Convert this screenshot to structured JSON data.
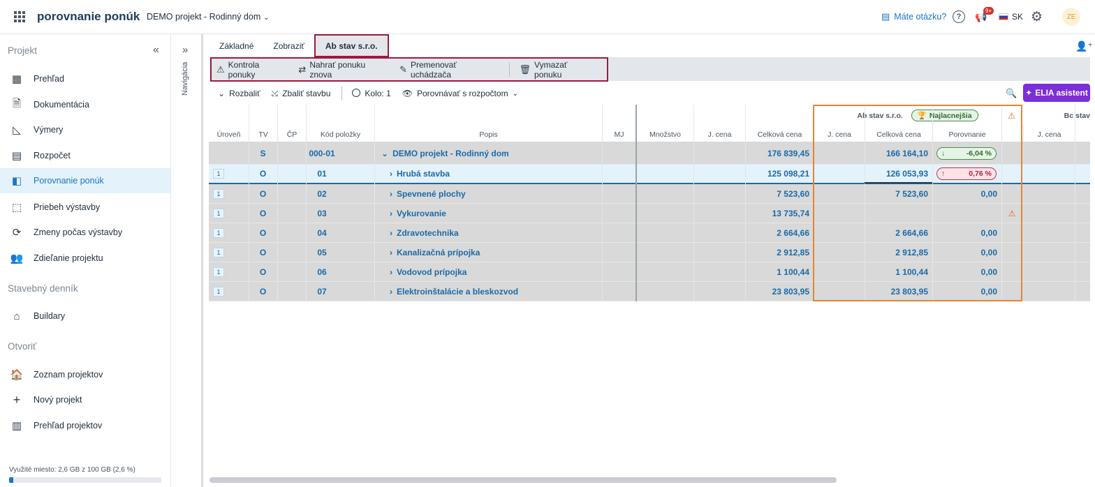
{
  "header": {
    "app_title": "porovnanie ponúk",
    "project": "DEMO projekt - Rodinný dom",
    "help": "Máte otázku?",
    "notif_badge": "9+",
    "language": "SK",
    "avatar": "ZE"
  },
  "sidebar": {
    "section_project": "Projekt",
    "section_diary": "Stavebný denník",
    "section_open": "Otvoriť",
    "items_project": [
      {
        "label": "Prehľad",
        "icon": "dashboard-icon"
      },
      {
        "label": "Dokumentácia",
        "icon": "document-icon"
      },
      {
        "label": "Výmery",
        "icon": "measure-icon"
      },
      {
        "label": "Rozpočet",
        "icon": "budget-icon"
      },
      {
        "label": "Porovnanie ponúk",
        "icon": "compare-icon",
        "active": true
      },
      {
        "label": "Priebeh výstavby",
        "icon": "progress-icon"
      },
      {
        "label": "Zmeny počas výstavby",
        "icon": "changes-icon"
      },
      {
        "label": "Zdieľanie projektu",
        "icon": "people-icon"
      }
    ],
    "items_diary": [
      {
        "label": "Buildary",
        "icon": "buildary-icon"
      }
    ],
    "items_open": [
      {
        "label": "Zoznam projektov",
        "icon": "home-icon"
      },
      {
        "label": "Nový projekt",
        "icon": "plus-icon"
      },
      {
        "label": "Prehľad projektov",
        "icon": "report-icon"
      }
    ],
    "storage_label": "Využité miesto: 2,6 GB z 100 GB (2,6 %)",
    "storage_percent": 2.6
  },
  "navcol": {
    "label": "Navigácia"
  },
  "tabs": [
    "Základné",
    "Zobraziť",
    "Ab stav s.r.o."
  ],
  "actions": [
    {
      "label": "Kontrola ponuky",
      "icon": "warning-icon"
    },
    {
      "label": "Nahrať ponuku znova",
      "icon": "repeat-icon"
    },
    {
      "label": "Premenovať uchádzača",
      "icon": "pencil-icon"
    },
    {
      "label": "Vymazať ponuku",
      "icon": "trash-icon"
    }
  ],
  "toolbar": {
    "expand": "Rozbaliť",
    "collapse": "Zbaliť stavbu",
    "round": "Kolo: 1",
    "compare": "Porovnávať s rozpočtom",
    "elia": "ELIA asistent"
  },
  "grid": {
    "columns": {
      "level": "Úroveň",
      "tv": "TV",
      "cp": "ČP",
      "code": "Kód položky",
      "desc": "Popis",
      "mj": "MJ",
      "qty": "Množstvo",
      "unit_price": "J. cena",
      "total": "Celková cena",
      "b_unit": "J. cena",
      "b_total": "Celková cena",
      "b_compare": "Porovnanie",
      "c_unit": "J. cena"
    },
    "bidder_a": "Ab stav s.r.o.",
    "best_badge": "Najlacnejšia",
    "bidder_b": "Bc stav",
    "rows": [
      {
        "level": "",
        "tv": "S",
        "code": "000-01",
        "desc": "DEMO projekt - Rodinný dom",
        "total": "176 839,45",
        "b_total": "166 164,10",
        "compare": "-6,04 %",
        "trend": "down",
        "expanded": true
      },
      {
        "level": "1",
        "tv": "O",
        "code": "01",
        "desc": "Hrubá stavba",
        "total": "125 098,21",
        "b_total": "126 053,93",
        "compare": "0,76 %",
        "trend": "up"
      },
      {
        "level": "1",
        "tv": "O",
        "code": "02",
        "desc": "Spevnené plochy",
        "total": "7 523,60",
        "b_total": "7 523,60",
        "compare": "0,00",
        "trend": "none"
      },
      {
        "level": "1",
        "tv": "O",
        "code": "03",
        "desc": "Vykurovanie",
        "total": "13 735,74",
        "b_total": "",
        "compare": "",
        "trend": "warn"
      },
      {
        "level": "1",
        "tv": "O",
        "code": "04",
        "desc": "Zdravotechnika",
        "total": "2 664,66",
        "b_total": "2 664,66",
        "compare": "0,00",
        "trend": "none"
      },
      {
        "level": "1",
        "tv": "O",
        "code": "05",
        "desc": "Kanalizačná prípojka",
        "total": "2 912,85",
        "b_total": "2 912,85",
        "compare": "0,00",
        "trend": "none"
      },
      {
        "level": "1",
        "tv": "O",
        "code": "06",
        "desc": "Vodovod prípojka",
        "total": "1 100,44",
        "b_total": "1 100,44",
        "compare": "0,00",
        "trend": "none"
      },
      {
        "level": "1",
        "tv": "O",
        "code": "07",
        "desc": "Elektroinštalácie a bleskozvod",
        "total": "23 803,95",
        "b_total": "23 803,95",
        "compare": "0,00",
        "trend": "none"
      }
    ]
  },
  "colors": {
    "accent": "#1a76c2",
    "highlight_border": "#9c1b3e",
    "bidder_border": "#e0863a",
    "elia": "#7b2fd6"
  }
}
